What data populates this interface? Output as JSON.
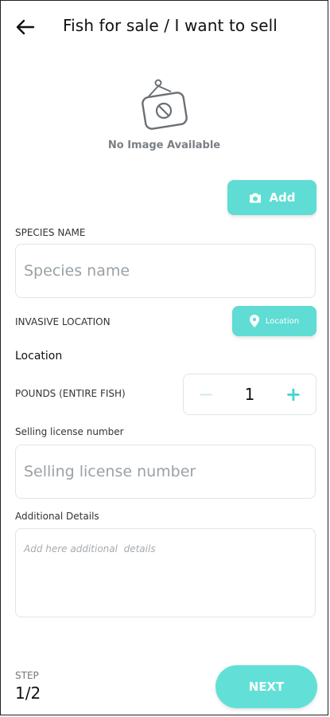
{
  "header": {
    "title": "Fish for sale / I want to sell"
  },
  "image": {
    "placeholder_text": "No Image Available",
    "add_label": "Add"
  },
  "form": {
    "species_label": "SPECIES NAME",
    "species_placeholder": "Species name",
    "invasive_label": "INVASIVE LOCATION",
    "location_button_label": "Location",
    "location_value": "Location",
    "pounds_label": "POUNDS (ENTIRE FISH)",
    "pounds_value": "1",
    "minus": "−",
    "plus": "+",
    "license_label": "Selling license number",
    "license_placeholder": "Selling license number",
    "details_label": "Additional Details",
    "details_placeholder": "Add here additional  details"
  },
  "footer": {
    "step_label": "STEP",
    "step_count": "1/2",
    "next_label": "NEXT"
  },
  "colors": {
    "accent": "#5fdcd4",
    "border": "#dfe5e8",
    "muted_text": "#7a7f84"
  }
}
